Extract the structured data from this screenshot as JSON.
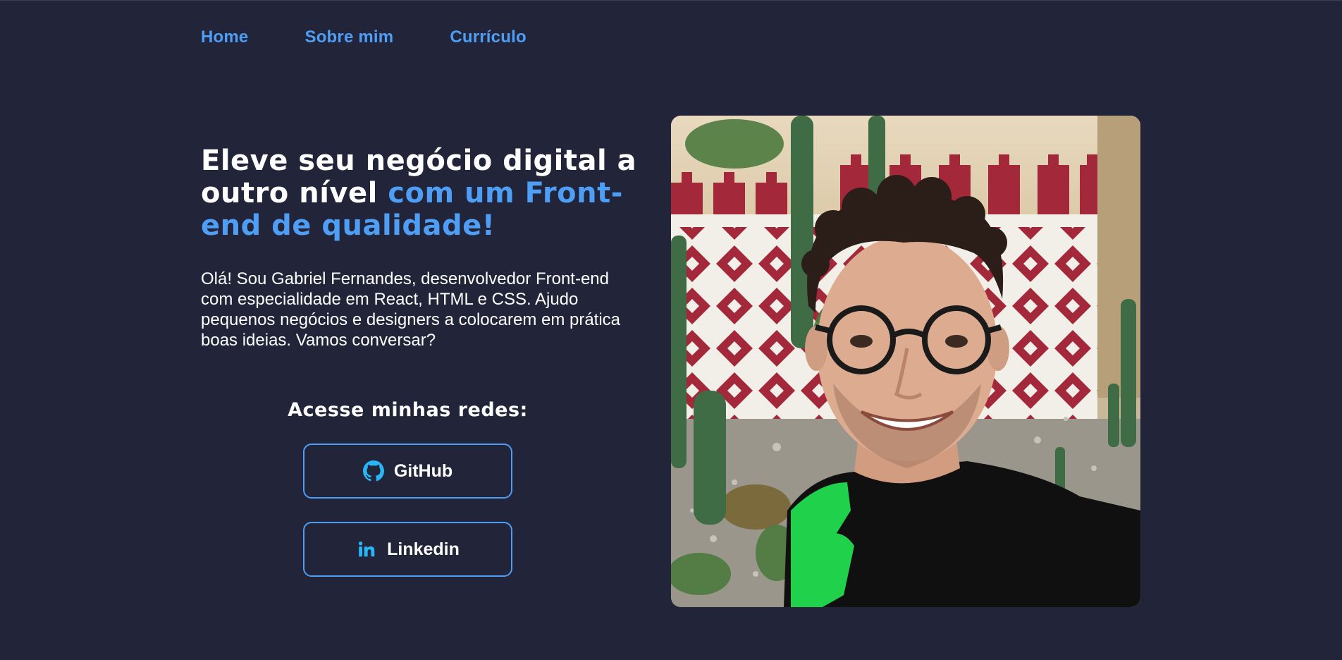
{
  "nav": {
    "items": [
      {
        "label": "Home"
      },
      {
        "label": "Sobre mim"
      },
      {
        "label": "Currículo"
      }
    ]
  },
  "hero": {
    "headline_part1": "Eleve seu negócio digital a outro nível ",
    "headline_part2": "com um Front-end de qualidade!",
    "intro": "Olá! Sou Gabriel Fernandes, desenvolvedor Front-end com especialidade em React, HTML e CSS. Ajudo pequenos negócios e designers a colocarem em prática boas ideias. Vamos conversar?",
    "socials_title": "Acesse minhas redes:",
    "github_label": "GitHub",
    "linkedin_label": "Linkedin"
  },
  "icons": {
    "github": "github-icon",
    "linkedin": "linkedin-icon"
  },
  "colors": {
    "background": "#22243a",
    "accent": "#4f9ef5",
    "icon": "#29b6f6",
    "text": "#ffffff"
  }
}
